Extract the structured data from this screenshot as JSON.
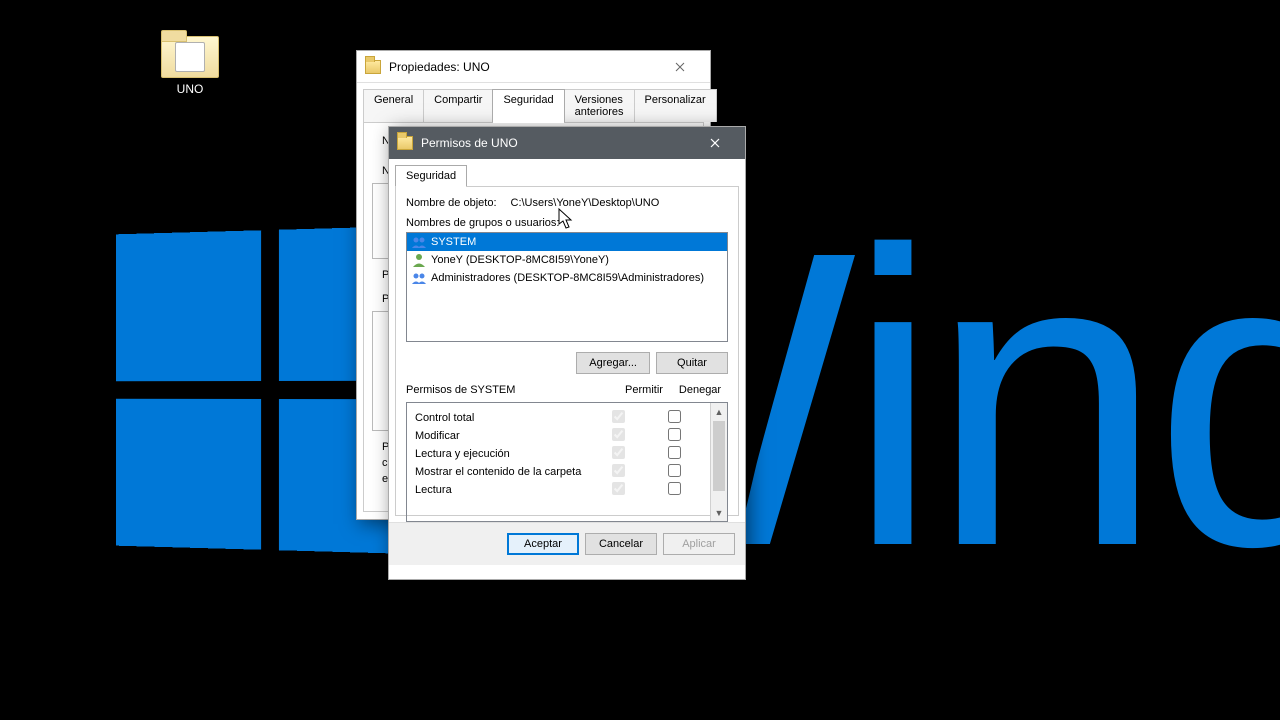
{
  "desktop": {
    "folder_name": "UNO",
    "brand_text": "Wind"
  },
  "props_window": {
    "title": "Propiedades: UNO",
    "tabs": [
      "General",
      "Compartir",
      "Seguridad",
      "Versiones anteriores",
      "Personalizar"
    ],
    "active_tab_index": 2,
    "visible_fragments": {
      "line1": "No",
      "line2": "No",
      "line3_a": "Pa",
      "line3_b": "Pe",
      "line4_a": "Pa",
      "line4_b": "co",
      "line4_c": "en"
    }
  },
  "perm_window": {
    "title": "Permisos de UNO",
    "tab": "Seguridad",
    "object_label": "Nombre de objeto:",
    "object_path": "C:\\Users\\YoneY\\Desktop\\UNO",
    "groups_label": "Nombres de grupos o usuarios:",
    "users": [
      {
        "name": "SYSTEM",
        "type": "group",
        "selected": true
      },
      {
        "name": "YoneY (DESKTOP-8MC8I59\\YoneY)",
        "type": "user",
        "selected": false
      },
      {
        "name": "Administradores (DESKTOP-8MC8I59\\Administradores)",
        "type": "group",
        "selected": false
      }
    ],
    "btn_add": "Agregar...",
    "btn_remove": "Quitar",
    "perm_for_prefix": "Permisos de",
    "perm_for_target": "SYSTEM",
    "col_allow": "Permitir",
    "col_deny": "Denegar",
    "permissions": [
      {
        "name": "Control total",
        "allow": true,
        "deny": false
      },
      {
        "name": "Modificar",
        "allow": true,
        "deny": false
      },
      {
        "name": "Lectura y ejecución",
        "allow": true,
        "deny": false
      },
      {
        "name": "Mostrar el contenido de la carpeta",
        "allow": true,
        "deny": false
      },
      {
        "name": "Lectura",
        "allow": true,
        "deny": false
      }
    ],
    "btn_ok": "Aceptar",
    "btn_cancel": "Cancelar",
    "btn_apply": "Aplicar"
  }
}
